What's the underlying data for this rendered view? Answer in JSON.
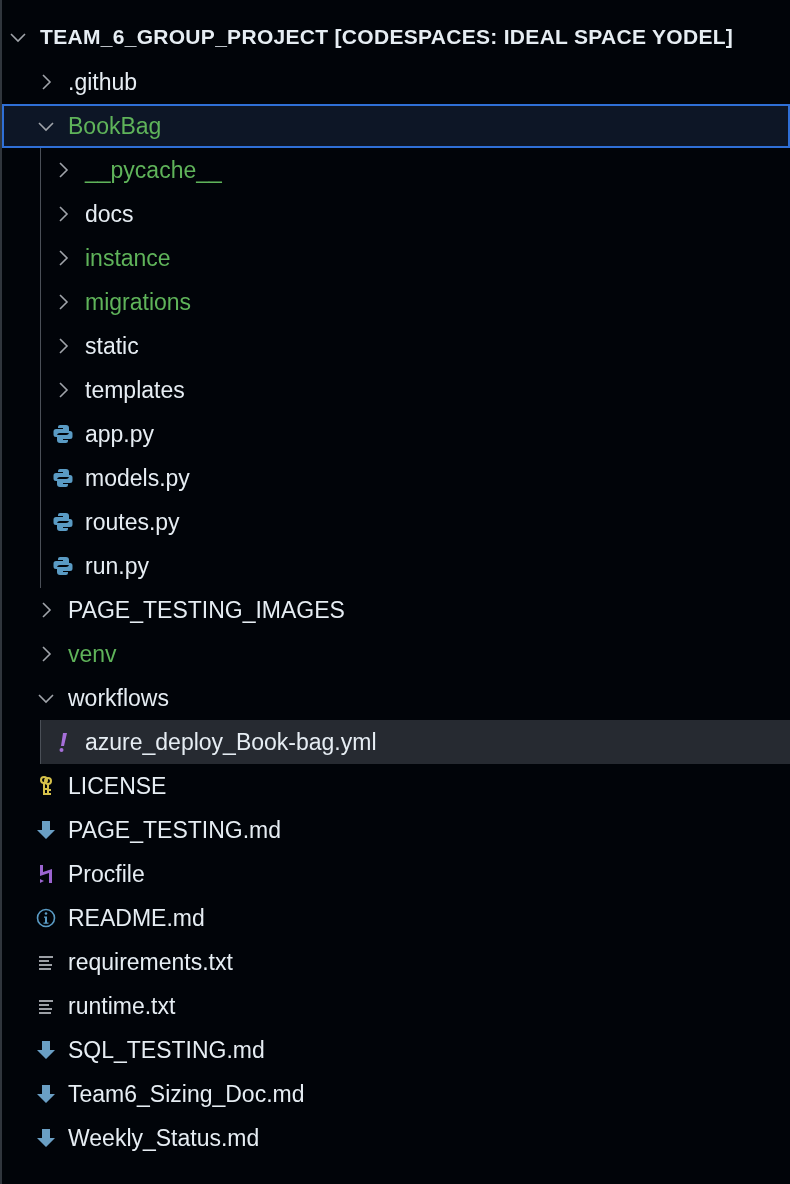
{
  "explorer": {
    "title": "TEAM_6_GROUP_PROJECT [CODESPACES: IDEAL SPACE YODEL]",
    "expanded": true,
    "items": [
      {
        "kind": "folder",
        "name": ".github",
        "expanded": false,
        "focused": false,
        "selected": false,
        "color": "#e6edf3"
      },
      {
        "kind": "folder",
        "name": "BookBag",
        "expanded": true,
        "focused": true,
        "selected": false,
        "color": "#5fb35a",
        "children": [
          {
            "kind": "folder",
            "name": "__pycache__",
            "expanded": false,
            "focused": false,
            "selected": false,
            "color": "#5fb35a"
          },
          {
            "kind": "folder",
            "name": "docs",
            "expanded": false,
            "focused": false,
            "selected": false,
            "color": "#e6edf3"
          },
          {
            "kind": "folder",
            "name": "instance",
            "expanded": false,
            "focused": false,
            "selected": false,
            "color": "#5fb35a"
          },
          {
            "kind": "folder",
            "name": "migrations",
            "expanded": false,
            "focused": false,
            "selected": false,
            "color": "#5fb35a"
          },
          {
            "kind": "folder",
            "name": "static",
            "expanded": false,
            "focused": false,
            "selected": false,
            "color": "#e6edf3"
          },
          {
            "kind": "folder",
            "name": "templates",
            "expanded": false,
            "focused": false,
            "selected": false,
            "color": "#e6edf3"
          },
          {
            "kind": "python",
            "name": "app.py",
            "focused": false,
            "selected": false,
            "color": "#e6edf3"
          },
          {
            "kind": "python",
            "name": "models.py",
            "focused": false,
            "selected": false,
            "color": "#e6edf3"
          },
          {
            "kind": "python",
            "name": "routes.py",
            "focused": false,
            "selected": false,
            "color": "#e6edf3"
          },
          {
            "kind": "python",
            "name": "run.py",
            "focused": false,
            "selected": false,
            "color": "#e6edf3"
          }
        ]
      },
      {
        "kind": "folder",
        "name": "PAGE_TESTING_IMAGES",
        "expanded": false,
        "focused": false,
        "selected": false,
        "color": "#e6edf3"
      },
      {
        "kind": "folder",
        "name": "venv",
        "expanded": false,
        "focused": false,
        "selected": false,
        "color": "#5fb35a"
      },
      {
        "kind": "folder",
        "name": "workflows",
        "expanded": true,
        "focused": false,
        "selected": false,
        "color": "#e6edf3",
        "children": [
          {
            "kind": "yaml",
            "name": "azure_deploy_Book-bag.yml",
            "focused": false,
            "selected": true,
            "color": "#e6edf3"
          }
        ]
      },
      {
        "kind": "license",
        "name": "LICENSE",
        "focused": false,
        "selected": false,
        "color": "#e6edf3"
      },
      {
        "kind": "markdown",
        "name": "PAGE_TESTING.md",
        "focused": false,
        "selected": false,
        "color": "#e6edf3"
      },
      {
        "kind": "heroku",
        "name": "Procfile",
        "focused": false,
        "selected": false,
        "color": "#e6edf3"
      },
      {
        "kind": "info",
        "name": "README.md",
        "focused": false,
        "selected": false,
        "color": "#e6edf3"
      },
      {
        "kind": "text",
        "name": "requirements.txt",
        "focused": false,
        "selected": false,
        "color": "#e6edf3"
      },
      {
        "kind": "text",
        "name": "runtime.txt",
        "focused": false,
        "selected": false,
        "color": "#e6edf3"
      },
      {
        "kind": "markdown",
        "name": "SQL_TESTING.md",
        "focused": false,
        "selected": false,
        "color": "#e6edf3"
      },
      {
        "kind": "markdown",
        "name": "Team6_Sizing_Doc.md",
        "focused": false,
        "selected": false,
        "color": "#e6edf3"
      },
      {
        "kind": "markdown",
        "name": "Weekly_Status.md",
        "focused": false,
        "selected": false,
        "color": "#e6edf3"
      }
    ]
  }
}
